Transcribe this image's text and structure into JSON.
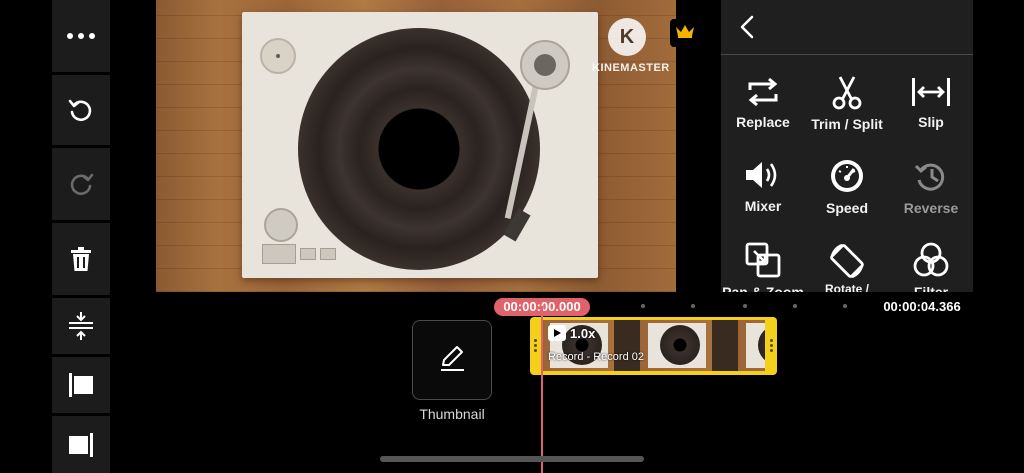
{
  "app": {
    "name": "KineMaster"
  },
  "preview": {
    "watermark_text": "KINEMASTER",
    "logo_letter": "K"
  },
  "left_toolbar": {
    "items": [
      {
        "name": "more-options",
        "icon": "ellipsis-icon"
      },
      {
        "name": "undo",
        "icon": "undo-icon"
      },
      {
        "name": "redo",
        "icon": "redo-icon"
      },
      {
        "name": "delete",
        "icon": "trash-icon"
      },
      {
        "name": "track-height",
        "icon": "expand-vertical-icon"
      },
      {
        "name": "jump-start",
        "icon": "jump-start-icon"
      },
      {
        "name": "jump-end",
        "icon": "jump-end-icon"
      }
    ]
  },
  "edit_panel": {
    "tools": [
      {
        "label": "Replace",
        "icon": "replace-icon",
        "enabled": true
      },
      {
        "label": "Trim / Split",
        "icon": "scissors-icon",
        "enabled": true
      },
      {
        "label": "Slip",
        "icon": "slip-icon",
        "enabled": true
      },
      {
        "label": "Mixer",
        "icon": "speaker-icon",
        "enabled": true
      },
      {
        "label": "Speed",
        "icon": "speedometer-icon",
        "enabled": true
      },
      {
        "label": "Reverse",
        "icon": "reverse-icon",
        "enabled": false
      },
      {
        "label": "Pan & Zoom",
        "icon": "pan-zoom-icon",
        "enabled": true
      },
      {
        "label": "Rotate /",
        "icon": "rotate-icon",
        "enabled": true
      },
      {
        "label": "Filter",
        "icon": "filter-icon",
        "enabled": true
      }
    ]
  },
  "timeline": {
    "current_time": "00:00:00.000",
    "end_time": "00:00:04.366",
    "thumbnail_label": "Thumbnail",
    "clip": {
      "speed": "1.0x",
      "name": "Record - Record 02"
    }
  },
  "colors": {
    "accent_red": "#e0626b",
    "clip_yellow": "#f4d01b",
    "panel_bg": "#1f1f1f",
    "crown_gold": "#f5b100"
  }
}
